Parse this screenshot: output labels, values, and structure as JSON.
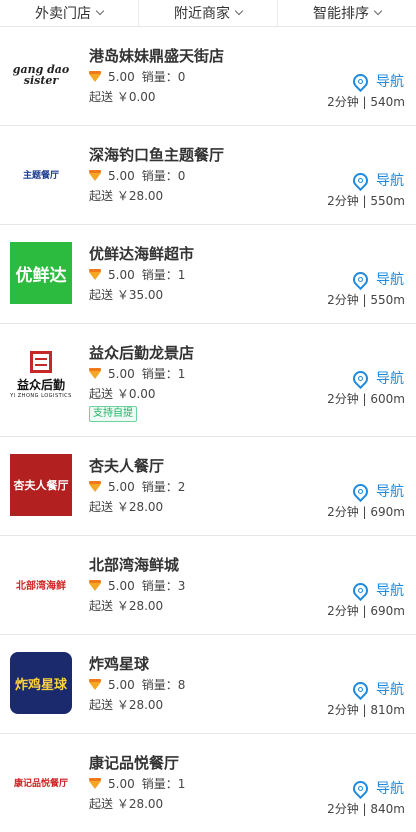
{
  "filters": [
    {
      "label": "外卖门店"
    },
    {
      "label": "附近商家"
    },
    {
      "label": "智能排序"
    }
  ],
  "common": {
    "score_label": "5.00",
    "sales_prefix": "销量：",
    "nav_label": "导航"
  },
  "stores": [
    {
      "name": "港岛妹妹鼎盛天街店",
      "sales": "0",
      "delivery": "起送 ￥0.00",
      "distance": "2分钟 | 540m",
      "logo_text": "gang dao sister"
    },
    {
      "name": "深海钓口鱼主题餐厅",
      "sales": "0",
      "delivery": "起送 ￥28.00",
      "distance": "2分钟 | 550m",
      "logo_text": "主题餐厅"
    },
    {
      "name": "优鲜达海鲜超市",
      "sales": "1",
      "delivery": "起送 ￥35.00",
      "distance": "2分钟 | 550m",
      "logo_text": "优鲜达"
    },
    {
      "name": "益众后勤龙景店",
      "sales": "1",
      "delivery": "起送 ￥0.00",
      "distance": "2分钟 | 600m",
      "logo_text": "益众后勤",
      "logo_sub": "YI ZHONG LOGISTICS",
      "tag": "支持自提"
    },
    {
      "name": "杏夫人餐厅",
      "sales": "2",
      "delivery": "起送 ￥28.00",
      "distance": "2分钟 | 690m",
      "logo_text": "杏夫人餐厅"
    },
    {
      "name": "北部湾海鲜城",
      "sales": "3",
      "delivery": "起送 ￥28.00",
      "distance": "2分钟 | 690m",
      "logo_text": "北部湾海鲜"
    },
    {
      "name": "炸鸡星球",
      "sales": "8",
      "delivery": "起送 ￥28.00",
      "distance": "2分钟 | 810m",
      "logo_text": "炸鸡星球"
    },
    {
      "name": "康记品悦餐厅",
      "sales": "1",
      "delivery": "起送 ￥28.00",
      "distance": "2分钟 | 840m",
      "logo_text": "康记品悦餐厅"
    }
  ]
}
